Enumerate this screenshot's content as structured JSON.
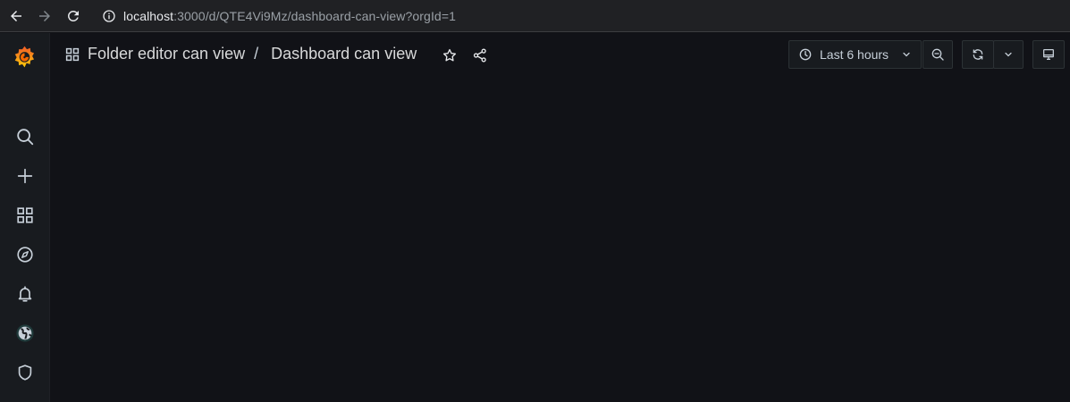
{
  "browser": {
    "url_host": "localhost",
    "url_rest": ":3000/d/QTE4Vi9Mz/dashboard-can-view?orgId=1",
    "icons": [
      "back-arrow-icon",
      "forward-arrow-icon",
      "reload-icon",
      "info-icon"
    ]
  },
  "sidemenu": {
    "items": [
      {
        "name": "search",
        "icon": "search-icon"
      },
      {
        "name": "create",
        "icon": "plus-icon"
      },
      {
        "name": "dashboards",
        "icon": "apps-grid-icon"
      },
      {
        "name": "explore",
        "icon": "compass-icon"
      },
      {
        "name": "alerting",
        "icon": "bell-icon"
      },
      {
        "name": "connections",
        "icon": "globe-icon"
      },
      {
        "name": "server-admin",
        "icon": "shield-icon"
      }
    ]
  },
  "topnav": {
    "folder_title": "Folder editor can view",
    "separator": "/",
    "dashboard_title": "Dashboard can view",
    "time_range_label": "Last 6 hours"
  },
  "colors": {
    "background": "#111217",
    "sidemenu": "#181b1f",
    "browser_bar": "#202124",
    "text": "#d8d9da",
    "logo_orange": "#f46800",
    "logo_yellow": "#fbca0a"
  }
}
